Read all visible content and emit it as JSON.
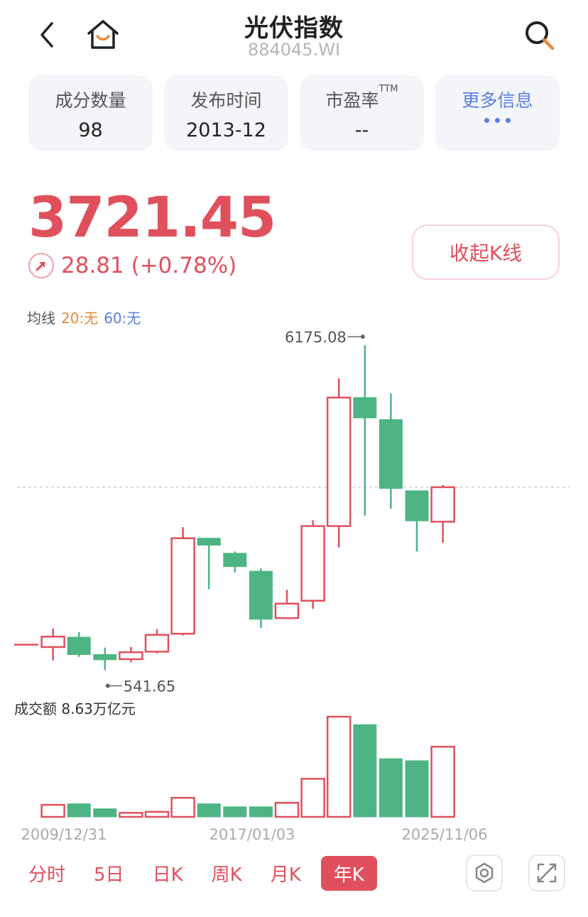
{
  "header": {
    "title": "光伏指数",
    "code": "884045.WI"
  },
  "cards": [
    {
      "label": "成分数量",
      "value": "98"
    },
    {
      "label": "发布时间",
      "value": "2013-12"
    },
    {
      "label": "市盈率",
      "sup": "TTM",
      "value": "--"
    },
    {
      "label": "更多信息",
      "value": ""
    }
  ],
  "quote": {
    "price": "3721.45",
    "change": "28.81 (+0.78%)",
    "collapse_label": "收起K线"
  },
  "ma": {
    "label": "均线",
    "ma20": "20:无",
    "ma60": "60:无"
  },
  "volume": {
    "label": "成交额 8.63万亿元"
  },
  "tabs": [
    "分时",
    "5日",
    "日K",
    "周K",
    "月K",
    "年K"
  ],
  "active_tab": "年K",
  "colors": {
    "up": "#e0505c",
    "down": "#4db583",
    "accent_blue": "#5b7fe0",
    "accent_orange": "#e88a3a"
  },
  "chart_data": {
    "type": "candlestick",
    "period": "yearly",
    "x_tick_labels": [
      "2009/12/31",
      "2017/01/03",
      "2025/11/06"
    ],
    "annotations": {
      "max": "6175.08",
      "min": "541.65"
    },
    "reference_line": 3721.45,
    "candles": [
      {
        "open": 1000,
        "close": 1000,
        "high": 1000,
        "low": 1000
      },
      {
        "open": 960,
        "close": 1140,
        "high": 1280,
        "low": 730
      },
      {
        "open": 1130,
        "close": 830,
        "high": 1220,
        "low": 790
      },
      {
        "open": 830,
        "close": 740,
        "high": 950,
        "low": 560
      },
      {
        "open": 750,
        "close": 870,
        "high": 960,
        "low": 700
      },
      {
        "open": 880,
        "close": 1170,
        "high": 1270,
        "low": 850
      },
      {
        "open": 1190,
        "close": 2840,
        "high": 3030,
        "low": 1160
      },
      {
        "open": 2840,
        "close": 2720,
        "high": 2760,
        "low": 1960
      },
      {
        "open": 2580,
        "close": 2350,
        "high": 2610,
        "low": 2250
      },
      {
        "open": 2270,
        "close": 1440,
        "high": 2320,
        "low": 1290
      },
      {
        "open": 1460,
        "close": 1710,
        "high": 1950,
        "low": 1450
      },
      {
        "open": 1760,
        "close": 3050,
        "high": 3150,
        "low": 1620
      },
      {
        "open": 3050,
        "close": 5270,
        "high": 5600,
        "low": 2680
      },
      {
        "open": 5270,
        "close": 4920,
        "high": 6175.08,
        "low": 3230
      },
      {
        "open": 4890,
        "close": 3700,
        "high": 5340,
        "low": 3350
      },
      {
        "open": 3660,
        "close": 3140,
        "high": 3650,
        "low": 2610
      },
      {
        "open": 3125,
        "close": 3721.45,
        "high": 3760,
        "low": 2760
      }
    ],
    "volumes": [
      0,
      0.12,
      0.13,
      0.08,
      0.04,
      0.05,
      0.19,
      0.13,
      0.1,
      0.1,
      0.14,
      0.38,
      1.0,
      0.92,
      0.58,
      0.56,
      0.7
    ]
  }
}
